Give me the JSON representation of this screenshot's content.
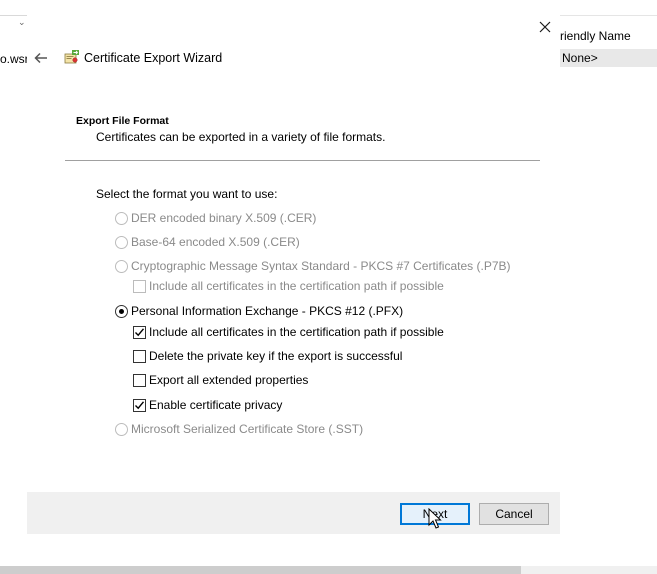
{
  "background": {
    "left_fragment_text": "o.wsr",
    "right_column_header": "riendly Name",
    "right_row_value": "None>"
  },
  "dialog": {
    "title": "Certificate Export Wizard",
    "section_title": "Export File Format",
    "section_description": "Certificates can be exported in a variety of file formats.",
    "prompt": "Select the format you want to use:",
    "options": [
      {
        "label": "DER encoded binary X.509 (.CER)",
        "type": "radio",
        "checked": false,
        "enabled": false
      },
      {
        "label": "Base-64 encoded X.509 (.CER)",
        "type": "radio",
        "checked": false,
        "enabled": false
      },
      {
        "label": "Cryptographic Message Syntax Standard - PKCS #7 Certificates (.P7B)",
        "type": "radio",
        "checked": false,
        "enabled": false
      },
      {
        "label": "Include all certificates in the certification path if possible",
        "type": "checkbox",
        "checked": false,
        "enabled": false
      },
      {
        "label": "Personal Information Exchange - PKCS #12 (.PFX)",
        "type": "radio",
        "checked": true,
        "enabled": true
      },
      {
        "label": "Include all certificates in the certification path if possible",
        "type": "checkbox",
        "checked": true,
        "enabled": true
      },
      {
        "label": "Delete the private key if the export is successful",
        "type": "checkbox",
        "checked": false,
        "enabled": true
      },
      {
        "label": "Export all extended properties",
        "type": "checkbox",
        "checked": false,
        "enabled": true
      },
      {
        "label": "Enable certificate privacy",
        "type": "checkbox",
        "checked": true,
        "enabled": true
      },
      {
        "label": "Microsoft Serialized Certificate Store (.SST)",
        "type": "radio",
        "checked": false,
        "enabled": false
      }
    ],
    "buttons": {
      "next": "Next",
      "cancel": "Cancel"
    }
  },
  "colors": {
    "accent": "#0078d7",
    "footer": "#f0f0f0",
    "disabled_text": "#8a8a8a"
  },
  "icons": {
    "close": "close-icon",
    "back": "back-arrow-icon",
    "wizard": "certificate-wizard-icon",
    "cursor": "mouse-pointer-icon"
  }
}
